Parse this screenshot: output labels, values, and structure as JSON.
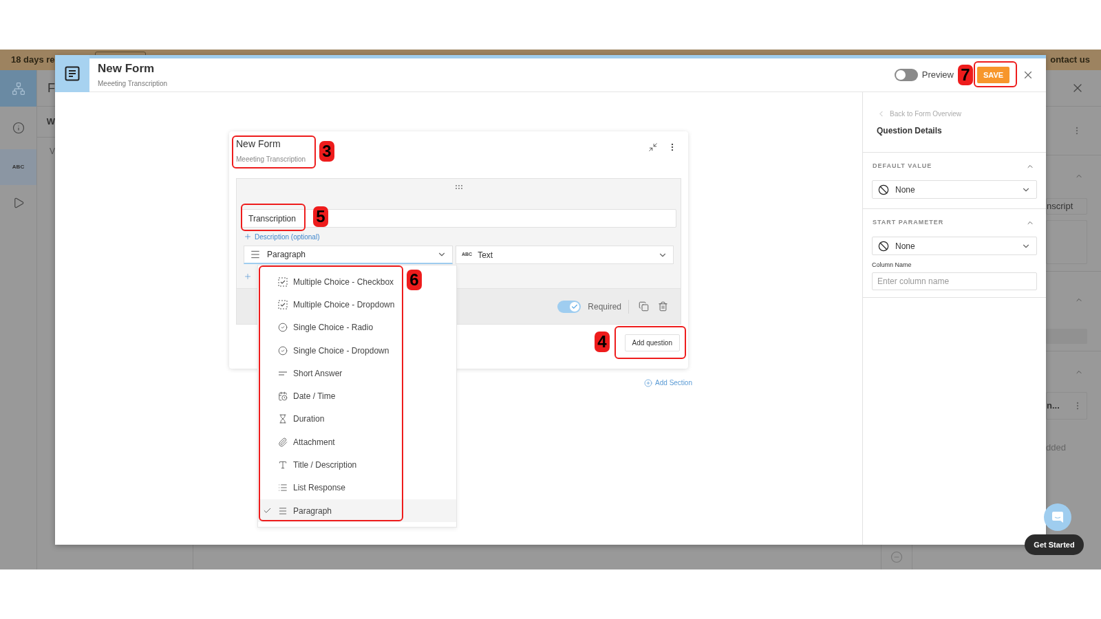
{
  "background": {
    "banner": {
      "left_text": "18 days re",
      "right_text": "ontact us"
    },
    "sidebar_badge": "ABC",
    "left_fragments": [
      "F",
      "W",
      "V"
    ],
    "right_fragments": {
      "field_value": "nscript",
      "item": "n...",
      "note": "dded"
    }
  },
  "modal": {
    "title": "New Form",
    "subtitle": "Meeeting Transcription",
    "preview": {
      "label": "Preview",
      "on": false
    },
    "save": "SAVE"
  },
  "form": {
    "title": "New Form",
    "subtitle": "Meeeting Transcription",
    "question": {
      "value": "Transcription",
      "description_link": "Description (optional)",
      "type_select": {
        "value": "Paragraph",
        "open": true
      },
      "data_type": {
        "badge": "ABC",
        "value": "Text"
      },
      "required": {
        "label": "Required",
        "on": true
      }
    },
    "add_question": "Add question",
    "add_section": "Add Section"
  },
  "type_menu": [
    {
      "kind": "checkbox",
      "label": "Multiple Choice - Checkbox",
      "selected": false
    },
    {
      "kind": "checkbox",
      "label": "Multiple Choice - Dropdown",
      "selected": false
    },
    {
      "kind": "radio",
      "label": "Single Choice - Radio",
      "selected": false
    },
    {
      "kind": "radio",
      "label": "Single Choice - Dropdown",
      "selected": false
    },
    {
      "kind": "short",
      "label": "Short Answer",
      "selected": false
    },
    {
      "kind": "datetime",
      "label": "Date / Time",
      "selected": false
    },
    {
      "kind": "duration",
      "label": "Duration",
      "selected": false
    },
    {
      "kind": "attachment",
      "label": "Attachment",
      "selected": false
    },
    {
      "kind": "title",
      "label": "Title / Description",
      "selected": false
    },
    {
      "kind": "list",
      "label": "List Response",
      "selected": false
    },
    {
      "kind": "paragraph",
      "label": "Paragraph",
      "selected": true
    }
  ],
  "details": {
    "back": "Back to Form Overview",
    "title": "Question Details",
    "sections": [
      {
        "heading": "DEFAULT VALUE",
        "expanded": true,
        "value": "None"
      },
      {
        "heading": "START PARAMETER",
        "expanded": true,
        "value": "None"
      }
    ],
    "column_name": {
      "label": "Column Name",
      "placeholder": "Enter column name"
    }
  },
  "chat": {
    "label": "Get Started"
  },
  "annotations": [
    {
      "label": "7"
    },
    {
      "label": "3"
    },
    {
      "label": "5"
    },
    {
      "label": "6"
    },
    {
      "label": "4"
    }
  ]
}
